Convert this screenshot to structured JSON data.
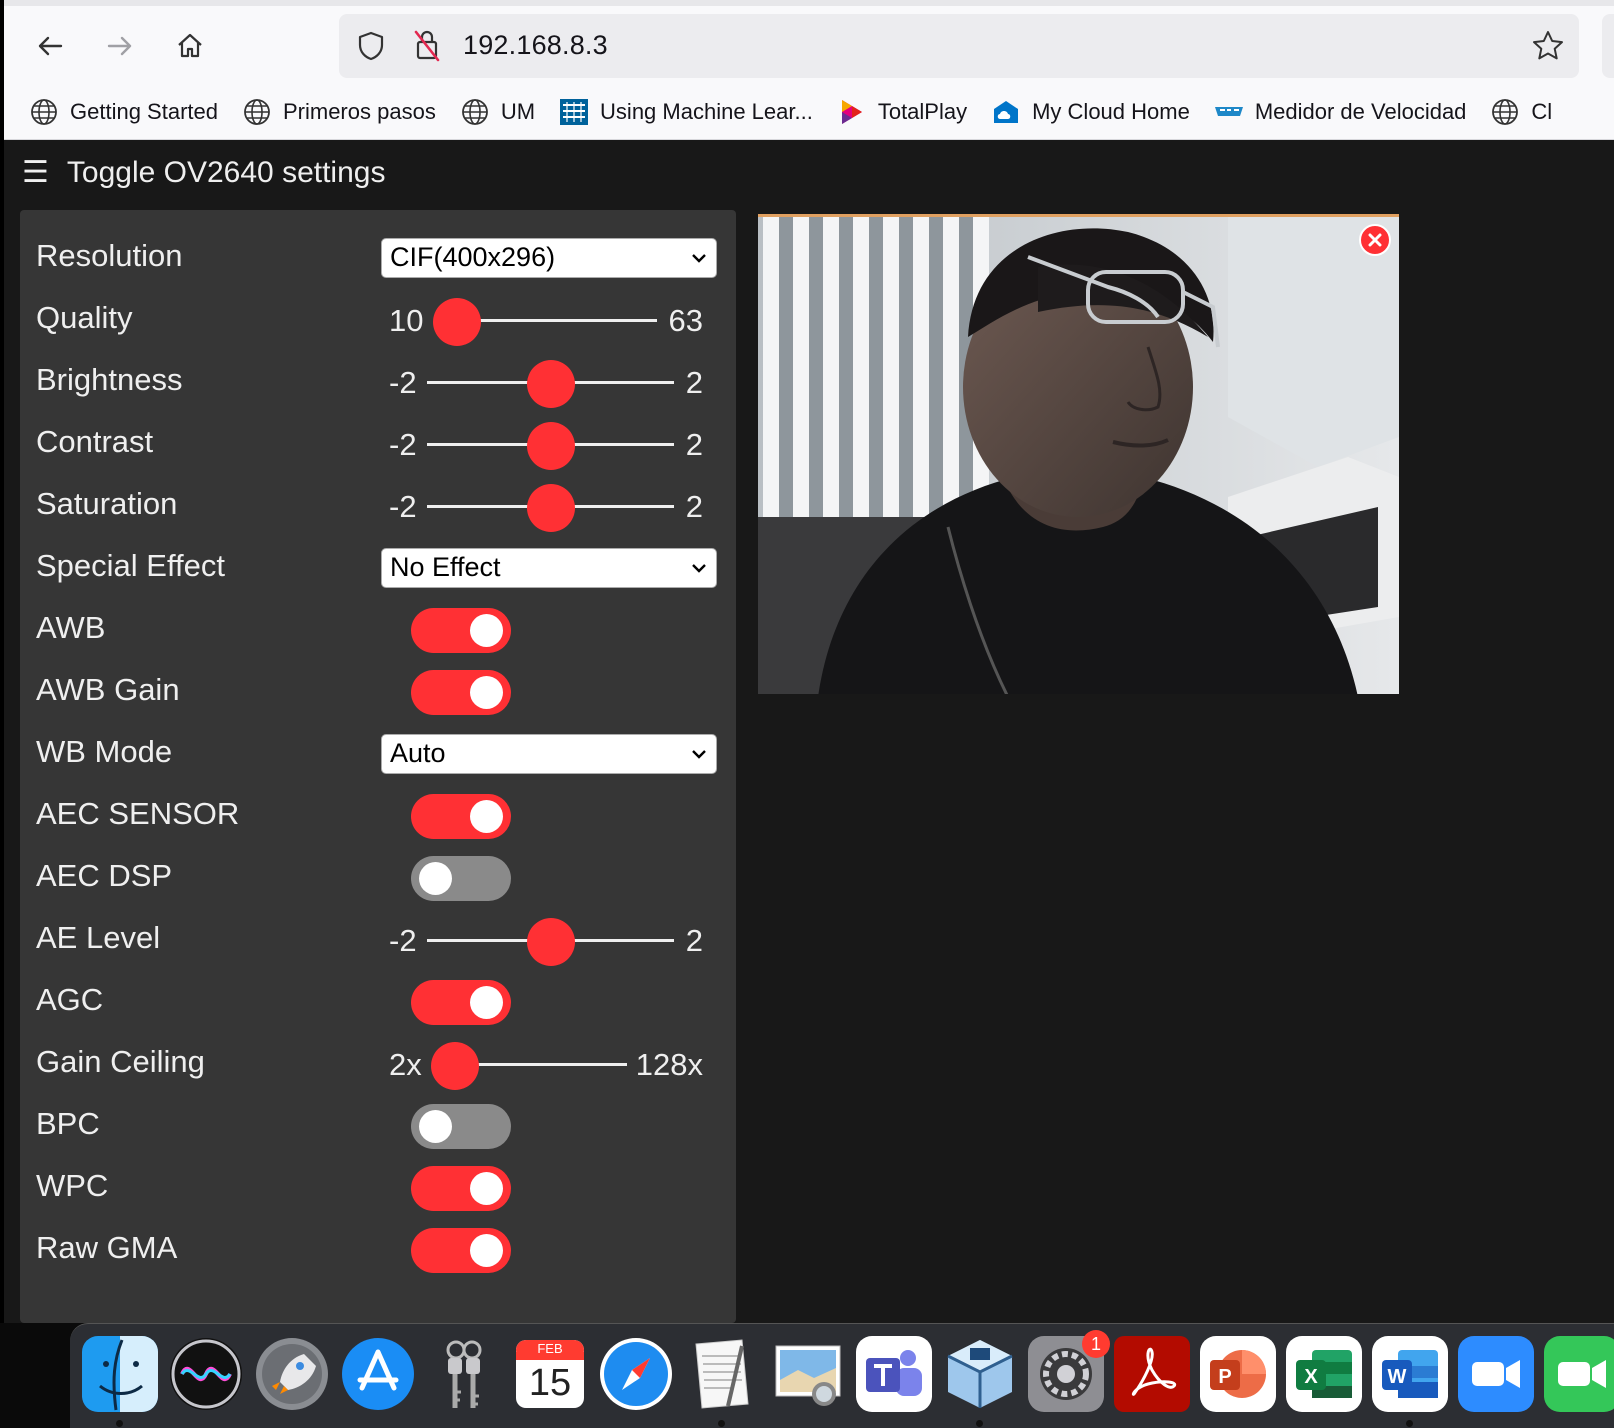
{
  "browser": {
    "url": "192.168.8.3",
    "bookmarks": [
      {
        "label": "Getting Started",
        "icon": "globe-icon"
      },
      {
        "label": "Primeros pasos",
        "icon": "globe-icon"
      },
      {
        "label": "UM",
        "icon": "globe-icon"
      },
      {
        "label": "Using Machine Lear...",
        "icon": "ieee-icon"
      },
      {
        "label": "TotalPlay",
        "icon": "totalplay-icon"
      },
      {
        "label": "My Cloud Home",
        "icon": "cloud-icon"
      },
      {
        "label": "Medidor de Velocidad",
        "icon": "speedometer-icon"
      },
      {
        "label": "Cl",
        "icon": "globe-icon"
      }
    ]
  },
  "page": {
    "toggle_label": "Toggle OV2640 settings",
    "accent_color": "#ff3034",
    "settings": [
      {
        "label": "Resolution",
        "type": "select",
        "value": "CIF(400x296)"
      },
      {
        "label": "Quality",
        "type": "range",
        "min": "10",
        "max": "63",
        "value": 10
      },
      {
        "label": "Brightness",
        "type": "range",
        "min": "-2",
        "max": "2",
        "value": 0
      },
      {
        "label": "Contrast",
        "type": "range",
        "min": "-2",
        "max": "2",
        "value": 0
      },
      {
        "label": "Saturation",
        "type": "range",
        "min": "-2",
        "max": "2",
        "value": 0
      },
      {
        "label": "Special Effect",
        "type": "select",
        "value": "No Effect"
      },
      {
        "label": "AWB",
        "type": "switch",
        "on": true
      },
      {
        "label": "AWB Gain",
        "type": "switch",
        "on": true
      },
      {
        "label": "WB Mode",
        "type": "select",
        "value": "Auto"
      },
      {
        "label": "AEC SENSOR",
        "type": "switch",
        "on": true
      },
      {
        "label": "AEC DSP",
        "type": "switch",
        "on": false
      },
      {
        "label": "AE Level",
        "type": "range",
        "min": "-2",
        "max": "2",
        "value": 0
      },
      {
        "label": "AGC",
        "type": "switch",
        "on": true
      },
      {
        "label": "Gain Ceiling",
        "type": "range",
        "min": "2x",
        "max": "128x",
        "value": 0
      },
      {
        "label": "BPC",
        "type": "switch",
        "on": false
      },
      {
        "label": "WPC",
        "type": "switch",
        "on": true
      },
      {
        "label": "Raw GMA",
        "type": "switch",
        "on": true
      }
    ]
  },
  "dock": {
    "items": [
      {
        "name": "finder-icon",
        "running": true
      },
      {
        "name": "siri-icon",
        "running": false
      },
      {
        "name": "launchpad-icon",
        "running": false
      },
      {
        "name": "app-store-icon",
        "running": false
      },
      {
        "name": "keychain-access-icon",
        "running": false
      },
      {
        "name": "calendar-icon",
        "running": false,
        "month": "FEB",
        "day": "15"
      },
      {
        "name": "safari-icon",
        "running": false
      },
      {
        "name": "textedit-icon",
        "running": true
      },
      {
        "name": "preview-icon",
        "running": false
      },
      {
        "name": "teams-icon",
        "running": false
      },
      {
        "name": "virtualbox-icon",
        "running": true
      },
      {
        "name": "system-preferences-icon",
        "running": false,
        "badge": "1"
      },
      {
        "name": "acrobat-icon",
        "running": false
      },
      {
        "name": "powerpoint-icon",
        "running": false
      },
      {
        "name": "excel-icon",
        "running": false
      },
      {
        "name": "word-icon",
        "running": true
      },
      {
        "name": "zoom-icon",
        "running": false
      }
    ]
  }
}
